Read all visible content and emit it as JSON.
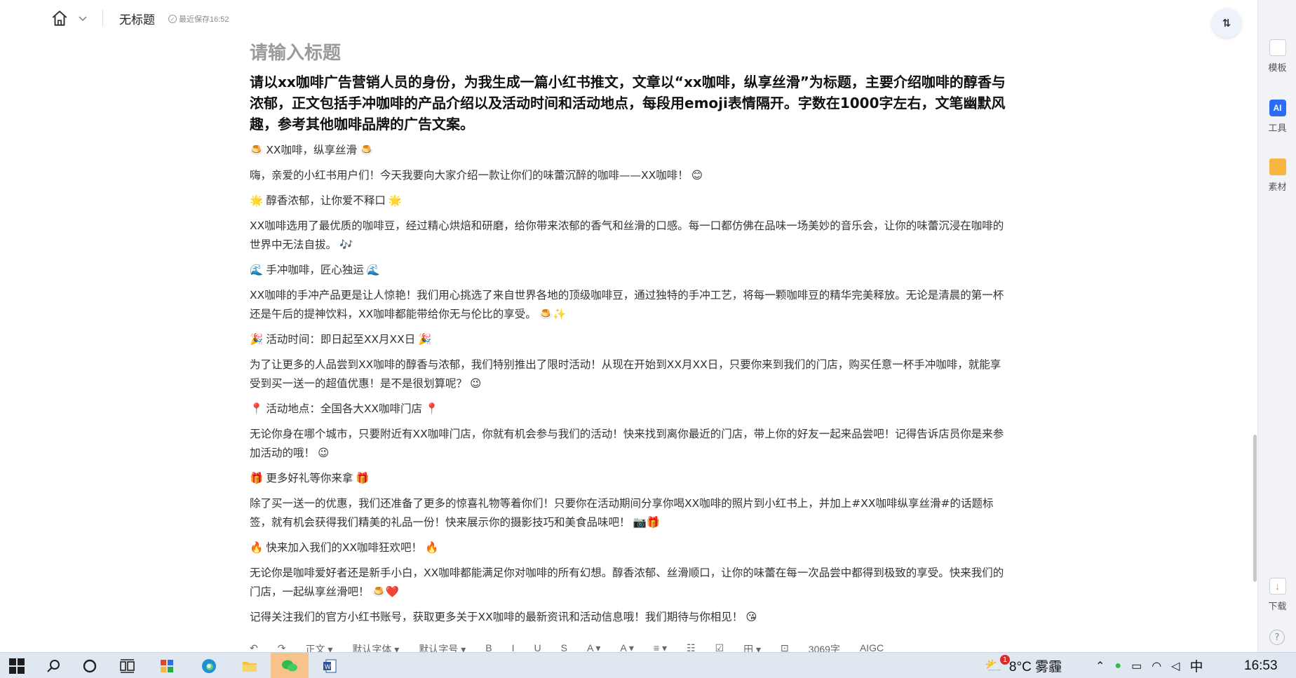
{
  "header": {
    "doc_title": "无标题",
    "save_status": "最近保存16:52",
    "sort_icon": "⇅"
  },
  "document": {
    "title_placeholder": "请输入标题",
    "prompt": "请以xx咖啡广告营销人员的身份，为我生成一篇小红书推文，文章以“xx咖啡，纵享丝滑”为标题，主要介绍咖啡的醇香与浓郁，正文包括手冲咖啡的产品介绍以及活动时间和活动地点，每段用emoji表情隔开。字数在1000字左右，文笔幽默风趣，参考其他咖啡品牌的广告文案。",
    "paragraphs": [
      {
        "pre": "🍮",
        "text": "XX咖啡，纵享丝滑",
        "post": "🍮"
      },
      {
        "pre": "",
        "text": "嗨，亲爱的小红书用户们！今天我要向大家介绍一款让你们的味蕾沉醉的咖啡——XX咖啡！",
        "post": "😊"
      },
      {
        "pre": "🌟",
        "text": "醇香浓郁，让你爱不释口",
        "post": "🌟"
      },
      {
        "pre": "",
        "text": "XX咖啡选用了最优质的咖啡豆，经过精心烘焙和研磨，给你带来浓郁的香气和丝滑的口感。每一口都仿佛在品味一场美妙的音乐会，让你的味蕾沉浸在咖啡的世界中无法自拔。",
        "post": "🎶"
      },
      {
        "pre": "🌊",
        "text": "手冲咖啡，匠心独运",
        "post": "🌊"
      },
      {
        "pre": "",
        "text": "XX咖啡的手冲产品更是让人惊艳！我们用心挑选了来自世界各地的顶级咖啡豆，通过独特的手冲工艺，将每一颗咖啡豆的精华完美释放。无论是清晨的第一杯还是午后的提神饮料，XX咖啡都能带给你无与伦比的享受。",
        "post": "🍮✨"
      },
      {
        "pre": "🎉",
        "text": "活动时间：即日起至XX月XX日",
        "post": "🎉"
      },
      {
        "pre": "",
        "text": "为了让更多的人品尝到XX咖啡的醇香与浓郁，我们特别推出了限时活动！从现在开始到XX月XX日，只要你来到我们的门店，购买任意一杯手冲咖啡，就能享受到买一送一的超值优惠！是不是很划算呢？",
        "post": "😉"
      },
      {
        "pre": "📍",
        "text": "活动地点：全国各大XX咖啡门店",
        "post": "📍"
      },
      {
        "pre": "",
        "text": "无论你身在哪个城市，只要附近有XX咖啡门店，你就有机会参与我们的活动！快来找到离你最近的门店，带上你的好友一起来品尝吧！记得告诉店员你是来参加活动的哦！",
        "post": "😉"
      },
      {
        "pre": "🎁",
        "text": "更多好礼等你来拿",
        "post": "🎁"
      },
      {
        "pre": "",
        "text": "除了买一送一的优惠，我们还准备了更多的惊喜礼物等着你们！只要你在活动期间分享你喝XX咖啡的照片到小红书上，并加上#XX咖啡纵享丝滑#的话题标签，就有机会获得我们精美的礼品一份！快来展示你的摄影技巧和美食品味吧！",
        "post": "📷🎁"
      },
      {
        "pre": "🔥",
        "text": "快来加入我们的XX咖啡狂欢吧！",
        "post": "🔥"
      },
      {
        "pre": "",
        "text": "无论你是咖啡爱好者还是新手小白，XX咖啡都能满足你对咖啡的所有幻想。醇香浓郁、丝滑顺口，让你的味蕾在每一次品尝中都得到极致的享受。快来我们的门店，一起纵享丝滑吧！",
        "post": "🍮❤️"
      },
      {
        "pre": "",
        "text": "记得关注我们的官方小红书账号，获取更多关于XX咖啡的最新资讯和活动信息哦！我们期待与你相见！",
        "post": "😘"
      }
    ]
  },
  "toolbar": {
    "items": [
      "↶",
      "↷",
      "正文 ▾",
      "默认字体 ▾",
      "默认字号 ▾",
      "B",
      "I",
      "U",
      "S",
      "A ▾",
      "A ▾",
      "≡ ▾",
      "☷",
      "☑",
      "田 ▾",
      "⊡",
      "3069字",
      "AIGC"
    ]
  },
  "right_panel": {
    "template": "模板",
    "ai_badge": "AI",
    "tools": "工具",
    "material": "素材",
    "download": "下载",
    "help": "?"
  },
  "taskbar": {
    "weather": "8°C 雾霾",
    "weather_badge": "1",
    "ime": "中",
    "time": "16:53"
  }
}
